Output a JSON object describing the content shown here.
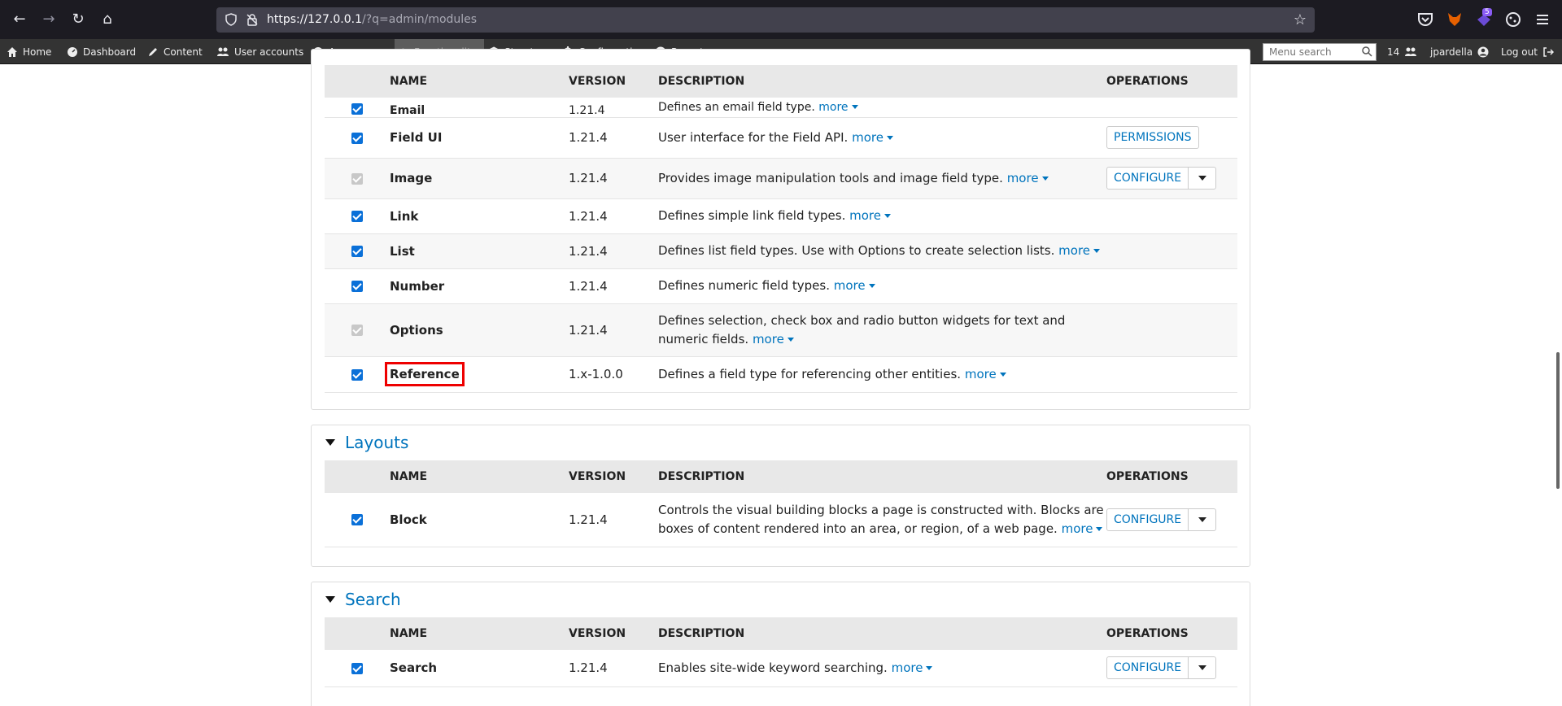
{
  "browser": {
    "url_host": "https://127.0.0.1",
    "url_path": "/?q=admin/modules",
    "extension_badge": "5"
  },
  "admin_toolbar": {
    "items": [
      {
        "label": "Home"
      },
      {
        "label": "Dashboard"
      },
      {
        "label": "Content"
      },
      {
        "label": "User accounts"
      },
      {
        "label": "Appearance"
      },
      {
        "label": "Functionality"
      },
      {
        "label": "Structure"
      },
      {
        "label": "Configuration"
      },
      {
        "label": "Reports"
      }
    ],
    "search_placeholder": "Menu search",
    "user_count": "14",
    "username": "jpardella",
    "logout": "Log out"
  },
  "headers": {
    "name": "NAME",
    "version": "VERSION",
    "description": "DESCRIPTION",
    "operations": "OPERATIONS"
  },
  "more_label": "more",
  "fields_modules": [
    {
      "name": "Email",
      "version": "1.21.4",
      "description": "Defines an email field type.",
      "checked": true,
      "disabled": false
    },
    {
      "name": "Field UI",
      "version": "1.21.4",
      "description": "User interface for the Field API.",
      "op": "PERMISSIONS",
      "checked": true,
      "disabled": false
    },
    {
      "name": "Image",
      "version": "1.21.4",
      "description": "Provides image manipulation tools and image field type.",
      "op": "CONFIGURE",
      "checked": true,
      "disabled": true
    },
    {
      "name": "Link",
      "version": "1.21.4",
      "description": "Defines simple link field types.",
      "checked": true,
      "disabled": false
    },
    {
      "name": "List",
      "version": "1.21.4",
      "description": "Defines list field types. Use with Options to create selection lists.",
      "checked": true,
      "disabled": false
    },
    {
      "name": "Number",
      "version": "1.21.4",
      "description": "Defines numeric field types.",
      "checked": true,
      "disabled": false
    },
    {
      "name": "Options",
      "version": "1.21.4",
      "description": "Defines selection, check box and radio button widgets for text and numeric fields.",
      "checked": true,
      "disabled": true
    },
    {
      "name": "Reference",
      "version": "1.x-1.0.0",
      "description": "Defines a field type for referencing other entities.",
      "checked": true,
      "disabled": false
    }
  ],
  "layouts": {
    "legend": "Layouts",
    "modules": [
      {
        "name": "Block",
        "version": "1.21.4",
        "description": "Controls the visual building blocks a page is constructed with. Blocks are boxes of content rendered into an area, or region, of a web page.",
        "op": "CONFIGURE"
      }
    ]
  },
  "search": {
    "legend": "Search",
    "modules": [
      {
        "name": "Search",
        "version": "1.21.4",
        "description": "Enables site-wide keyword searching.",
        "op": "CONFIGURE"
      }
    ]
  }
}
